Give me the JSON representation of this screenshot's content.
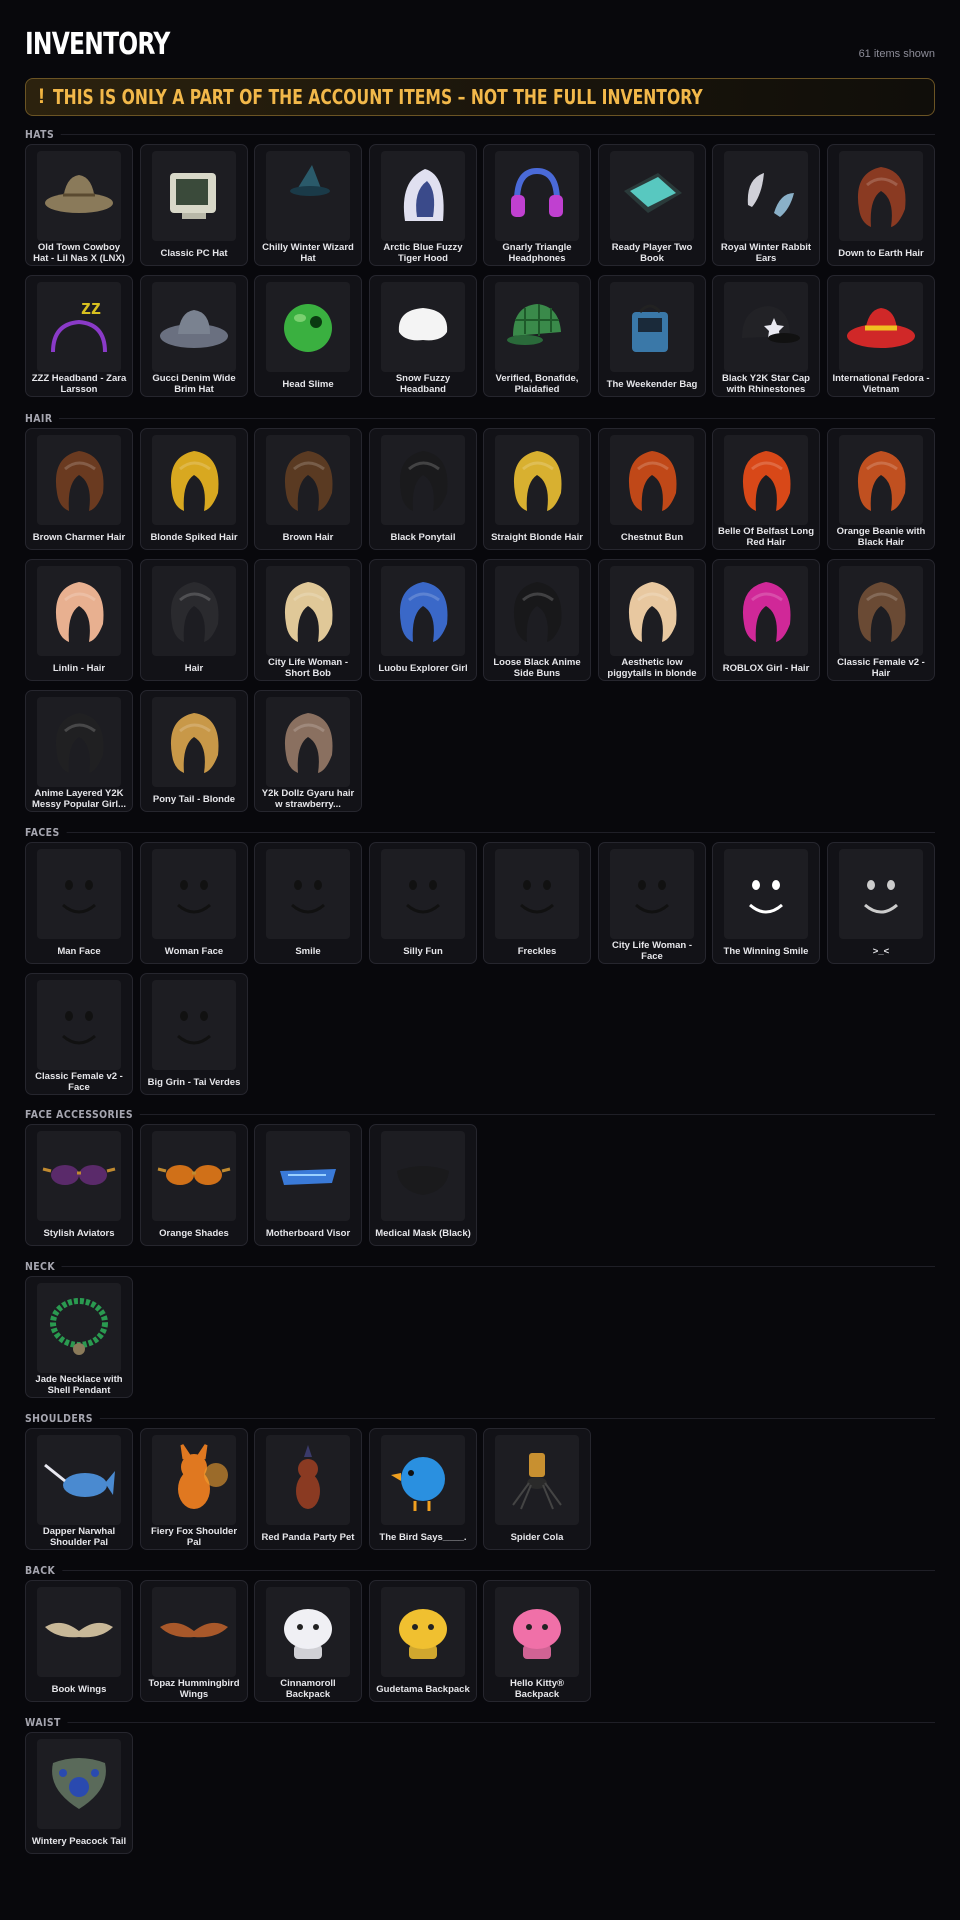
{
  "page": {
    "title": "INVENTORY",
    "count": "61 items shown",
    "notice_icon": "!",
    "notice": "THIS IS ONLY A PART OF THE ACCOUNT ITEMS – NOT THE FULL INVENTORY"
  },
  "sections": [
    {
      "label": "HATS",
      "items": [
        {
          "name": "Old Town Cowboy Hat - Lil Nas X (LNX)",
          "icon": "cowboy-hat-icon",
          "color": "#8a7a5a"
        },
        {
          "name": "Classic PC Hat",
          "icon": "pc-monitor-icon",
          "color": "#d8d8c8"
        },
        {
          "name": "Chilly Winter Wizard Hat",
          "icon": "wizard-hat-icon",
          "color": "#2a5a6a"
        },
        {
          "name": "Arctic Blue Fuzzy Tiger Hood",
          "icon": "tiger-hood-icon",
          "color": "#e0e0f0"
        },
        {
          "name": "Gnarly Triangle Headphones",
          "icon": "headphones-icon",
          "color": "#c040d0"
        },
        {
          "name": "Ready Player Two Book",
          "icon": "book-icon",
          "color": "#58c8c0"
        },
        {
          "name": "Royal Winter Rabbit Ears",
          "icon": "rabbit-ears-icon",
          "color": "#d0d0d8"
        },
        {
          "name": "Down to Earth Hair",
          "icon": "hair-icon",
          "color": "#8a3a22"
        },
        {
          "name": "ZZZ Headband - Zara Larsson",
          "icon": "zzz-headband-icon",
          "color": "#8a3ac8"
        },
        {
          "name": "Gucci Denim Wide Brim Hat",
          "icon": "wide-brim-hat-icon",
          "color": "#6a7080"
        },
        {
          "name": "Head Slime",
          "icon": "slime-icon",
          "color": "#3ab040"
        },
        {
          "name": "Snow Fuzzy Headband",
          "icon": "fuzzy-headband-icon",
          "color": "#f4f4f4"
        },
        {
          "name": "Verified, Bonafide, Plaidafied",
          "icon": "plaid-cap-icon",
          "color": "#3a8a4a"
        },
        {
          "name": "The Weekender Bag",
          "icon": "bag-icon",
          "color": "#3a78a8"
        },
        {
          "name": "Black Y2K Star Cap with Rhinestones",
          "icon": "star-cap-icon",
          "color": "#222226"
        },
        {
          "name": "International Fedora - Vietnam",
          "icon": "fedora-icon",
          "color": "#d02828"
        }
      ]
    },
    {
      "label": "HAIR",
      "items": [
        {
          "name": "Brown Charmer Hair",
          "icon": "hair-icon",
          "color": "#6a3a20"
        },
        {
          "name": "Blonde Spiked Hair",
          "icon": "hair-icon",
          "color": "#d8a820"
        },
        {
          "name": "Brown Hair",
          "icon": "hair-icon",
          "color": "#5a3a22"
        },
        {
          "name": "Black Ponytail",
          "icon": "hair-icon",
          "color": "#1a1a1c"
        },
        {
          "name": "Straight Blonde Hair",
          "icon": "hair-icon",
          "color": "#d8b030"
        },
        {
          "name": "Chestnut Bun",
          "icon": "hair-icon",
          "color": "#c04818"
        },
        {
          "name": "Belle Of Belfast Long Red Hair",
          "icon": "hair-icon",
          "color": "#d84818"
        },
        {
          "name": "Orange Beanie with Black Hair",
          "icon": "hair-icon",
          "color": "#c05020"
        },
        {
          "name": "Linlin - Hair",
          "icon": "hair-icon",
          "color": "#e8b090"
        },
        {
          "name": "Hair",
          "icon": "hair-icon",
          "color": "#2a2a2e"
        },
        {
          "name": "City Life Woman - Short Bob",
          "icon": "hair-icon",
          "color": "#e0c898"
        },
        {
          "name": "Luobu Explorer Girl",
          "icon": "hair-icon",
          "color": "#3a68c8"
        },
        {
          "name": "Loose Black Anime Side Buns",
          "icon": "hair-icon",
          "color": "#18181a"
        },
        {
          "name": "Aesthetic low piggytails in blonde",
          "icon": "hair-icon",
          "color": "#e8c8a0"
        },
        {
          "name": "ROBLOX Girl - Hair",
          "icon": "hair-icon",
          "color": "#d02898"
        },
        {
          "name": "Classic Female v2 - Hair",
          "icon": "hair-icon",
          "color": "#6a4a34"
        },
        {
          "name": "Anime Layered Y2K Messy Popular Girl...",
          "icon": "hair-icon",
          "color": "#202022"
        },
        {
          "name": "Pony Tail - Blonde",
          "icon": "hair-icon",
          "color": "#c89848"
        },
        {
          "name": "Y2k Dollz Gyaru hair w strawberry...",
          "icon": "hair-icon",
          "color": "#8a7060"
        }
      ]
    },
    {
      "label": "FACES",
      "items": [
        {
          "name": "Man Face",
          "icon": "face-icon",
          "color": "#111111"
        },
        {
          "name": "Woman Face",
          "icon": "face-icon",
          "color": "#111111"
        },
        {
          "name": "Smile",
          "icon": "face-icon",
          "color": "#111111"
        },
        {
          "name": "Silly Fun",
          "icon": "face-icon",
          "color": "#111111"
        },
        {
          "name": "Freckles",
          "icon": "face-icon",
          "color": "#111111"
        },
        {
          "name": "City Life Woman - Face",
          "icon": "face-icon",
          "color": "#3a2418"
        },
        {
          "name": "The Winning Smile",
          "icon": "face-icon",
          "color": "#ffffff"
        },
        {
          "name": ">_<",
          "icon": "face-icon",
          "color": "#cccccc"
        },
        {
          "name": "Classic Female v2 - Face",
          "icon": "face-icon",
          "color": "#3a2a18"
        },
        {
          "name": "Big Grin - Tai Verdes",
          "icon": "face-icon",
          "color": "#3a2010"
        }
      ]
    },
    {
      "label": "FACE ACCESSORIES",
      "items": [
        {
          "name": "Stylish Aviators",
          "icon": "sunglasses-icon",
          "color": "#5a2a6a"
        },
        {
          "name": "Orange Shades",
          "icon": "sunglasses-icon",
          "color": "#d07018"
        },
        {
          "name": "Motherboard Visor",
          "icon": "visor-icon",
          "color": "#3a7ad8"
        },
        {
          "name": "Medical Mask (Black)",
          "icon": "mask-icon",
          "color": "#1a1a1c"
        }
      ]
    },
    {
      "label": "NECK",
      "items": [
        {
          "name": "Jade Necklace with Shell Pendant",
          "icon": "necklace-icon",
          "color": "#2a9a50"
        }
      ]
    },
    {
      "label": "SHOULDERS",
      "items": [
        {
          "name": "Dapper Narwhal Shoulder Pal",
          "icon": "narwhal-icon",
          "color": "#4a8ad0"
        },
        {
          "name": "Fiery Fox Shoulder Pal",
          "icon": "fox-icon",
          "color": "#e07820"
        },
        {
          "name": "Red Panda Party Pet",
          "icon": "red-panda-icon",
          "color": "#8a3a22"
        },
        {
          "name": "The Bird Says____.",
          "icon": "bird-icon",
          "color": "#2a90e0"
        },
        {
          "name": "Spider Cola",
          "icon": "spider-icon",
          "color": "#2a2a2a"
        }
      ]
    },
    {
      "label": "BACK",
      "items": [
        {
          "name": "Book Wings",
          "icon": "wings-icon",
          "color": "#c8b898"
        },
        {
          "name": "Topaz Hummingbird Wings",
          "icon": "wings-icon",
          "color": "#a8582a"
        },
        {
          "name": "Cinnamoroll Backpack",
          "icon": "backpack-icon",
          "color": "#f0f0f4"
        },
        {
          "name": "Gudetama Backpack",
          "icon": "backpack-icon",
          "color": "#f0c030"
        },
        {
          "name": "Hello Kitty® Backpack",
          "icon": "backpack-icon",
          "color": "#f070a8"
        }
      ]
    },
    {
      "label": "WAIST",
      "items": [
        {
          "name": "Wintery Peacock Tail",
          "icon": "peacock-tail-icon",
          "color": "#2a4ab0"
        }
      ]
    }
  ]
}
